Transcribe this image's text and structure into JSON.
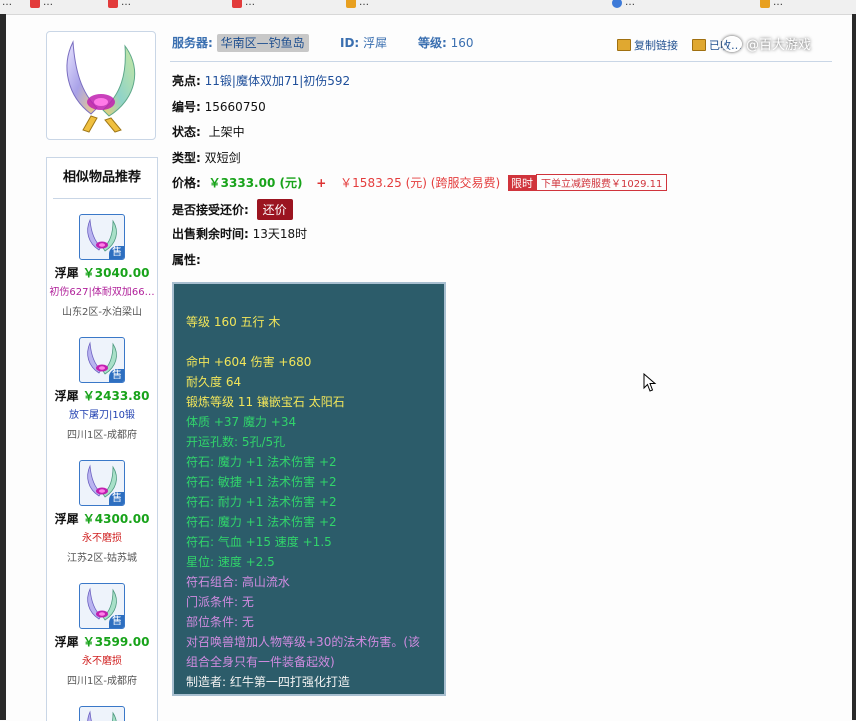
{
  "bookmarks": [
    {
      "label": "…",
      "color": "#e23b3b"
    },
    {
      "label": "…",
      "color": "#e23b3b"
    },
    {
      "label": "…",
      "color": "#e23b3b"
    },
    {
      "label": "…",
      "color": "#e23b3b"
    },
    {
      "label": "…",
      "color": "#e8a020"
    },
    {
      "label": "…",
      "color": "#3d7ad8"
    },
    {
      "label": "…",
      "color": "#e8a020"
    }
  ],
  "header": {
    "server_label": "服务器:",
    "server_value": "华南区—钓鱼岛",
    "id_label": "ID:",
    "id_value": "浮犀",
    "level_label": "等级:",
    "level_value": "160",
    "copy_link": "复制链接",
    "collect": "已收…"
  },
  "watermark": {
    "text": "@百大游戏"
  },
  "item": {
    "highlight_label": "亮点:",
    "highlight_value": "11锻|魔体双加71|初伤592",
    "number_label": "编号:",
    "number_value": "15660750",
    "status_label": "状态:",
    "status_value": "上架中",
    "type_label": "类型:",
    "type_value": "双短剑",
    "price_label": "价格:",
    "price_value": "￥3333.00 (元)",
    "plus": "+",
    "fee_value": "￥1583.25 (元) (跨服交易费)",
    "limit_tag": "限时",
    "discount_text": "下单立减跨服费￥1029.11",
    "bargain_label": "是否接受还价:",
    "bargain_button": "还价",
    "remaining_label": "出售剩余时间:",
    "remaining_value": "13天18时",
    "attr_label": "属性:"
  },
  "attributes": [
    {
      "text": "等级 160 五行 木",
      "color": "yellow"
    },
    {
      "text": "",
      "color": "yellow"
    },
    {
      "text": "命中 +604 伤害 +680",
      "color": "yellow"
    },
    {
      "text": "耐久度 64",
      "color": "yellow"
    },
    {
      "text": "锻炼等级 11 镶嵌宝石 太阳石",
      "color": "yellow"
    },
    {
      "text": "体质 +37 魔力 +34",
      "color": "green"
    },
    {
      "text": "开运孔数: 5孔/5孔",
      "color": "green"
    },
    {
      "text": "符石: 魔力 +1 法术伤害 +2",
      "color": "green"
    },
    {
      "text": "符石: 敏捷 +1 法术伤害 +2",
      "color": "green"
    },
    {
      "text": "符石: 耐力 +1 法术伤害 +2",
      "color": "green"
    },
    {
      "text": "符石: 魔力 +1 法术伤害 +2",
      "color": "green"
    },
    {
      "text": "符石: 气血 +15 速度 +1.5",
      "color": "green"
    },
    {
      "text": "星位: 速度 +2.5",
      "color": "green"
    },
    {
      "text": "符石组合: 高山流水",
      "color": "purple"
    },
    {
      "text": "门派条件: 无",
      "color": "purple"
    },
    {
      "text": "部位条件: 无",
      "color": "purple"
    },
    {
      "text": "对召唤兽增加人物等级+30的法术伤害。(该",
      "color": "purple"
    },
    {
      "text": "组合全身只有一件装备起效)",
      "color": "purple"
    },
    {
      "text": "制造者: 红牛第一四打强化打造",
      "color": "white"
    }
  ],
  "sidebar": {
    "title": "相似物品推荐",
    "sale_tag": "售",
    "items": [
      {
        "server": "浮犀",
        "price": "￥3040.00",
        "highlight": "初伤627|体耐双加66…",
        "hl_color": "#b0209a",
        "area": "山东2区-水泊梁山"
      },
      {
        "server": "浮犀",
        "price": "￥2433.80",
        "highlight": "放下屠刀|10锻",
        "hl_color": "#1f3fb0",
        "area": "四川1区-成都府"
      },
      {
        "server": "浮犀",
        "price": "￥4300.00",
        "highlight": "永不磨损",
        "hl_color": "#d02020",
        "area": "江苏2区-姑苏城"
      },
      {
        "server": "浮犀",
        "price": "￥3599.00",
        "highlight": "永不磨损",
        "hl_color": "#d02020",
        "area": "四川1区-成都府"
      }
    ]
  },
  "colors": {
    "panel_bg": "#2c5c6a",
    "accent_blue": "#3a6fb0",
    "price_green": "#18a31a",
    "fee_red": "#e43c3c",
    "button_red": "#9b1420"
  }
}
